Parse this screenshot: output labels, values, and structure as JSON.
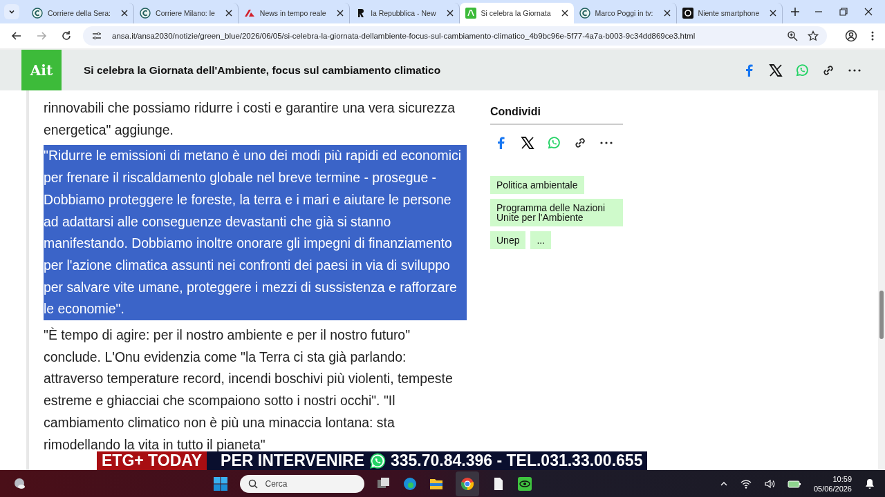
{
  "tabs": [
    {
      "title": "Corriere della Sera:",
      "selected": false
    },
    {
      "title": "Corriere Milano: le",
      "selected": false
    },
    {
      "title": "News in tempo reale",
      "selected": false
    },
    {
      "title": "la Repubblica - New",
      "selected": false
    },
    {
      "title": "Si celebra la Giornata",
      "selected": true
    },
    {
      "title": "Marco Poggi in tv:",
      "selected": false
    },
    {
      "title": "Niente smartphone",
      "selected": false
    }
  ],
  "address_bar": {
    "url": "ansa.it/ansa2030/notizie/green_blue/2026/06/05/si-celebra-la-giornata-dellambiente-focus-sul-cambiamento-climatico_4b9bc96e-5f77-4a7a-b003-9c34dd869ce3.html"
  },
  "header": {
    "logo": "Ait",
    "title": "Si celebra la Giornata dell'Ambiente, focus sul cambiamento climatico"
  },
  "article": {
    "paragraphs": [
      {
        "text": "rinnovabili che possiamo ridurre i costi e garantire una vera sicurezza energetica\" aggiunge.",
        "selected": false
      },
      {
        "text": "\"Ridurre le emissioni di metano è uno dei modi più rapidi ed economici per frenare il riscaldamento globale nel breve termine - prosegue - Dobbiamo proteggere le foreste, la terra e i mari e aiutare le persone ad adattarsi alle conseguenze devastanti che già si stanno manifestando. Dobbiamo inoltre onorare gli impegni di finanziamento per l'azione climatica assunti nei confronti dei paesi in via di sviluppo per salvare vite umane, proteggere i mezzi di sussistenza e rafforzare le economie\".",
        "selected": true
      },
      {
        "text": "\"È tempo di agire: per il nostro ambiente e per il nostro futuro\" conclude. L'Onu evidenzia come \"la Terra ci sta già parlando: attraverso temperature record, incendi boschivi più violenti, tempeste estreme e ghiacciai che scompaiono sotto i nostri occhi\". \"Il cambiamento climatico non è più una minaccia lontana: sta rimodellando la vita in tutto il pianeta\"",
        "selected": false
      }
    ]
  },
  "sidebar": {
    "share_title": "Condividi",
    "tags": [
      "Politica ambientale",
      "Programma delle Nazioni Unite per l'Ambiente",
      "Unep",
      "..."
    ]
  },
  "banner": {
    "label": "ETG+ TODAY",
    "text": "PER INTERVENIRE",
    "phone": "335.70.84.396 - TEL.031.33.00.655"
  },
  "taskbar": {
    "search_placeholder": "Cerca",
    "time": "10:59",
    "date": "05/06/2026"
  }
}
